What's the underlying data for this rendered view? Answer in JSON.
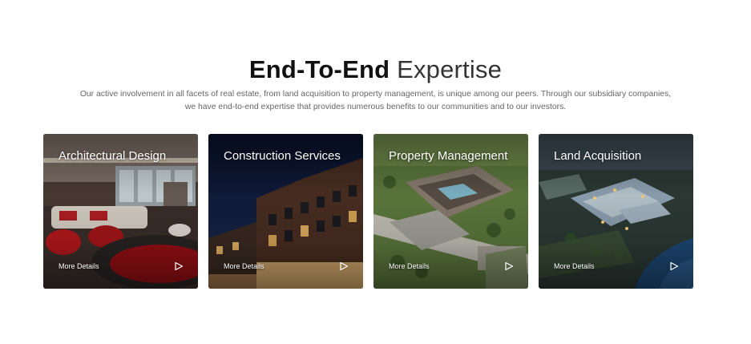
{
  "section": {
    "title_bold": "End-To-End",
    "title_light": "Expertise",
    "subtitle_line1": "Our active involvement in all facets of real estate, from land acquisition to property management, is unique among our peers. Through our subsidiary companies,",
    "subtitle_line2": "we have end-to-end expertise that provides numerous benefits to our communities and to our investors."
  },
  "cards": [
    {
      "title": "Architectural Design",
      "more_label": "More Details",
      "play_icon": "play-outline-icon"
    },
    {
      "title": "Construction Services",
      "more_label": "More Details",
      "play_icon": "play-outline-icon"
    },
    {
      "title": "Property Management",
      "more_label": "More Details",
      "play_icon": "play-outline-icon"
    },
    {
      "title": "Land Acquisition",
      "more_label": "More Details",
      "play_icon": "play-outline-icon"
    }
  ],
  "colors": {
    "background": "#ffffff",
    "heading": "#111111",
    "body_text": "#666666",
    "card_text": "#ffffff"
  }
}
